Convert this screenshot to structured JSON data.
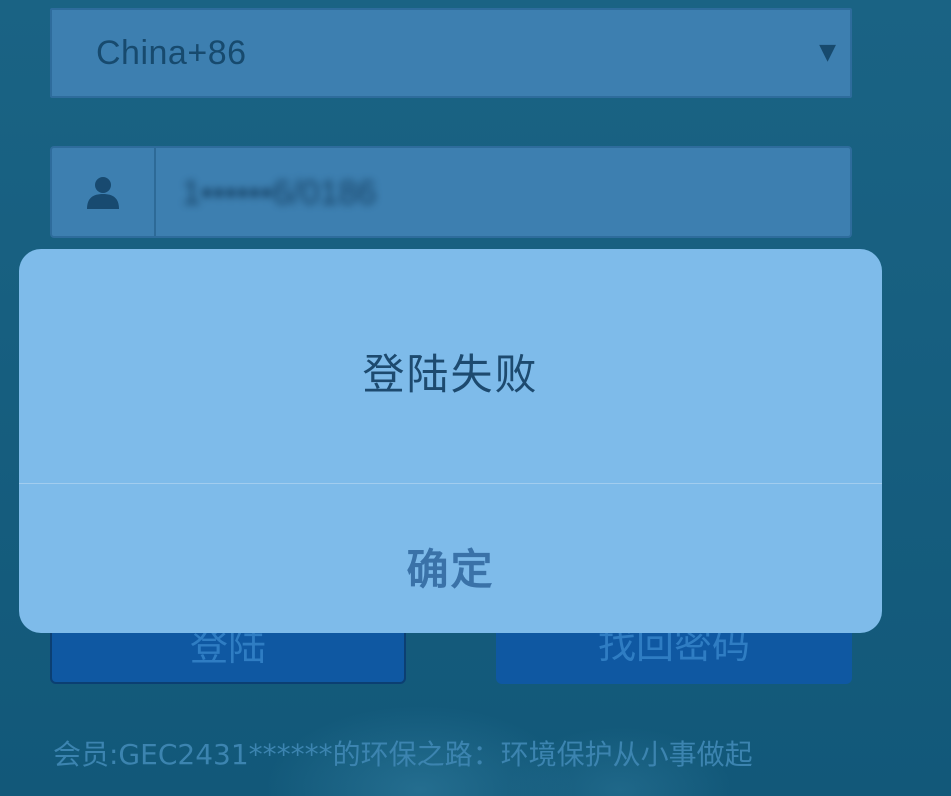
{
  "login_form": {
    "country": {
      "selected": "China+86",
      "arrow": "▼"
    },
    "phone": {
      "icon": "user-icon",
      "value": "1••••••6/0186"
    },
    "buttons": {
      "login": "登陆",
      "retrieve_password": "找回密码"
    },
    "footer": "会员:GEC2431******的环保之路：环境保护从小事做起"
  },
  "dialog": {
    "message": "登陆失败",
    "confirm_label": "确定"
  },
  "colors": {
    "background": "#165e7e",
    "field_fill": "#3d7fb0",
    "dialog_fill": "#7ebbea",
    "button_fill": "#0f58a2",
    "confirm_text": "#3a72a8"
  }
}
